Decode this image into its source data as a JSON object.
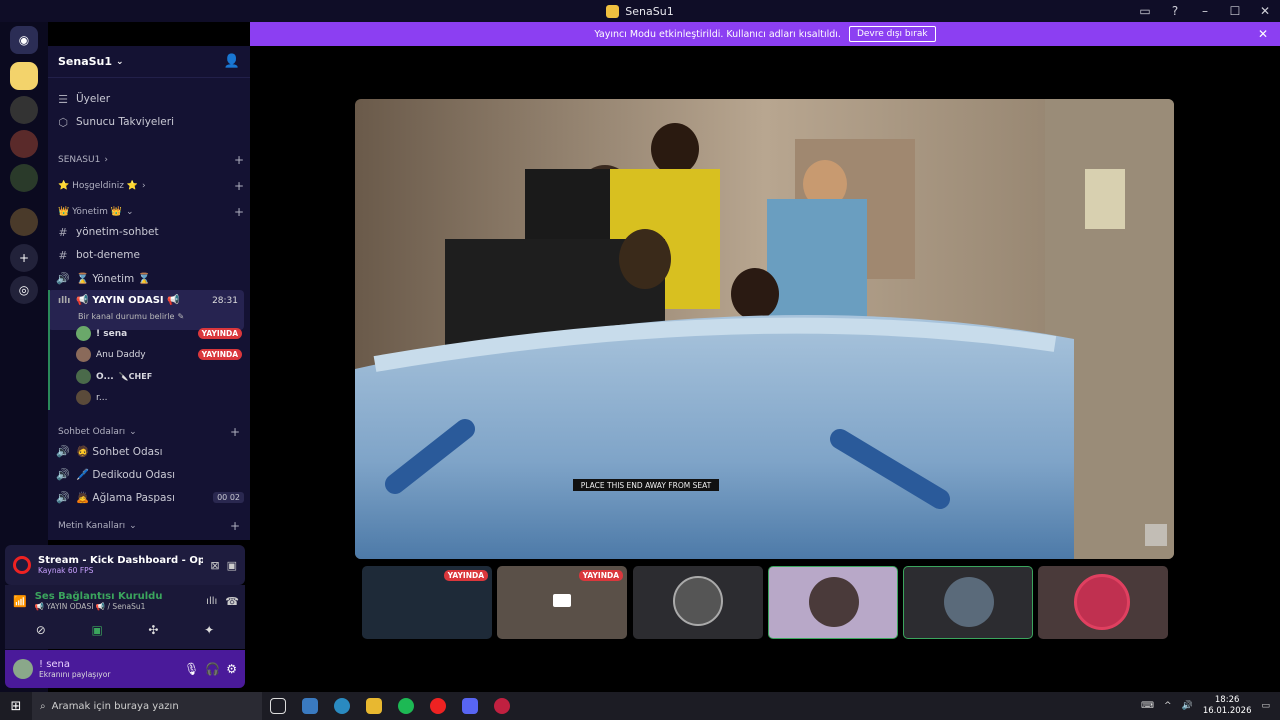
{
  "window": {
    "title": "SenaSu1"
  },
  "banner": {
    "text": "Yayıncı Modu etkinleştirildi. Kullanıcı adları kısaltıldı.",
    "button": "Devre dışı bırak"
  },
  "server": {
    "name": "SenaSu1"
  },
  "channels": {
    "top_items": [
      {
        "label": "Üyeler",
        "icon": "members-icon"
      },
      {
        "label": "Sunucu Takviyeleri",
        "icon": "boost-icon"
      }
    ],
    "categories": {
      "senasu1": "SENASU1",
      "hosgeldiniz": "⭐ Hoşgeldiniz ⭐",
      "yonetim": "👑 Yönetim 👑",
      "sohbet": "Sohbet Odaları",
      "metin": "Metin Kanalları"
    },
    "yonetim_items": [
      {
        "label": "yönetim-sohbet",
        "icon": "hash-icon"
      },
      {
        "label": "bot-deneme",
        "icon": "hash-icon"
      },
      {
        "label": "⌛ Yönetim ⌛",
        "icon": "speaker-icon"
      }
    ],
    "active_voice": {
      "name": "📢 YAYIN ODASI 📢",
      "time": "28:31",
      "status": "Bir kanal durumu belirle"
    },
    "voice_users": [
      {
        "name": "! sena",
        "badge": "YAYINDA",
        "color": "#6aa86a"
      },
      {
        "name": "Anu Daddy",
        "badge": "YAYINDA",
        "color": "#8a6a5a"
      },
      {
        "name": "O...",
        "extra": "🔪CHEF",
        "badge": "",
        "color": "#4a6a4a"
      },
      {
        "name": "r...",
        "badge": "",
        "color": "#5a4a3a"
      }
    ],
    "sohbet_items": [
      {
        "label": "🧔 Sohbet Odası",
        "icon": "speaker-icon",
        "counter": ""
      },
      {
        "label": "🖊️ Dedikodu Odası",
        "icon": "speaker-icon",
        "counter": ""
      },
      {
        "label": "🙇 Ağlama Paspası",
        "icon": "speaker-icon",
        "counter": "00 02"
      }
    ]
  },
  "stream_panel": {
    "title": "Stream - Kick Dashboard - Op...",
    "sub": "Kaynak 60 FPS"
  },
  "connection": {
    "title": "Ses Bağlantısı Kuruldu",
    "sub": "📢 YAYIN ODASI 📢 / SenaSu1"
  },
  "user": {
    "name": "! sena",
    "status": "Ekranını paylaşıyor"
  },
  "video": {
    "caption": "PLACE THIS END AWAY FROM SEAT"
  },
  "thumbs": [
    {
      "badge": "YAYINDA",
      "bg": "#1e2a38"
    },
    {
      "badge": "YAYINDA",
      "bg": "#5a5048"
    },
    {
      "badge": "",
      "bg": "#2c2c30"
    },
    {
      "badge": "",
      "bg": "#b8a8c8"
    },
    {
      "badge": "",
      "bg": "#2c2c30"
    },
    {
      "badge": "",
      "bg": "#4a3a3a"
    }
  ],
  "taskbar": {
    "search": "Aramak için buraya yazın",
    "time": "18:26",
    "date": "16.01.2026"
  },
  "colors": {
    "accent": "#8c3ff2",
    "live": "#da373c",
    "sidebar": "#141233"
  }
}
